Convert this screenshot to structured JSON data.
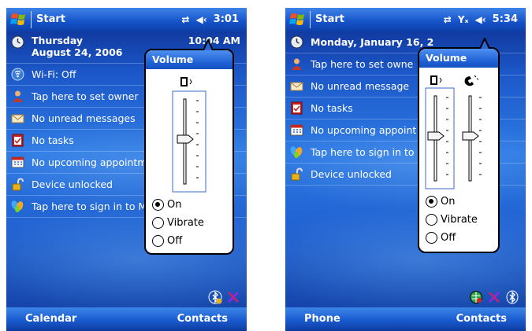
{
  "left": {
    "title": "Start",
    "time": "3:01",
    "date_line1": "Thursday",
    "date_line2": "August 24, 2006",
    "clock_time": "10:04 AM",
    "items": [
      {
        "icon": "wifi-icon",
        "text": "Wi-Fi: Off"
      },
      {
        "icon": "owner-icon",
        "text": "Tap here to set owner"
      },
      {
        "icon": "envelope-icon",
        "text": "No unread messages"
      },
      {
        "icon": "tasks-icon",
        "text": "No tasks"
      },
      {
        "icon": "calendar-icon",
        "text": "No upcoming appointm"
      },
      {
        "icon": "lock-icon",
        "text": "Device unlocked"
      },
      {
        "icon": "msn-butterfly-icon",
        "text": "Tap here to sign in to M"
      }
    ],
    "softkey_left": "Calendar",
    "softkey_right": "Contacts",
    "volume": {
      "title": "Volume",
      "options": [
        "On",
        "Vibrate",
        "Off"
      ],
      "selected": "On",
      "system_level": 0.5
    }
  },
  "right": {
    "title": "Start",
    "time": "5:34",
    "date_line1": "Monday, January 16, 2",
    "items": [
      {
        "icon": "owner-icon",
        "text": "Tap here to set owne"
      },
      {
        "icon": "envelope-icon",
        "text": "No unread message"
      },
      {
        "icon": "tasks-icon",
        "text": "No tasks"
      },
      {
        "icon": "calendar-icon",
        "text": "No upcoming appoint"
      },
      {
        "icon": "msn-butterfly-icon",
        "text": "Tap here to sign in to"
      },
      {
        "icon": "lock-icon",
        "text": "Device unlocked"
      }
    ],
    "softkey_left": "Phone",
    "softkey_right": "Contacts",
    "volume": {
      "title": "Volume",
      "options": [
        "On",
        "Vibrate",
        "Off"
      ],
      "selected": "On",
      "system_level": 0.5,
      "ringer_level": 0.5
    }
  }
}
